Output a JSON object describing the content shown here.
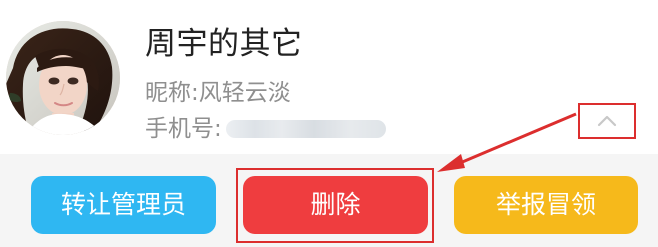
{
  "profile": {
    "name": "周宇的其它",
    "nickname": "昵称:风轻云淡",
    "phone_label": "手机号:"
  },
  "icons": {
    "avatar": "avatar-photo",
    "expand": "chevron-up-icon",
    "annotation": "red-arrow"
  },
  "actions": {
    "transfer_label": "转让管理员",
    "delete_label": "删除",
    "report_label": "举报冒领"
  },
  "colors": {
    "transfer": "#2fb7f2",
    "delete": "#ef3d3f",
    "report": "#f6b91b",
    "highlight": "#dc2e2e"
  }
}
